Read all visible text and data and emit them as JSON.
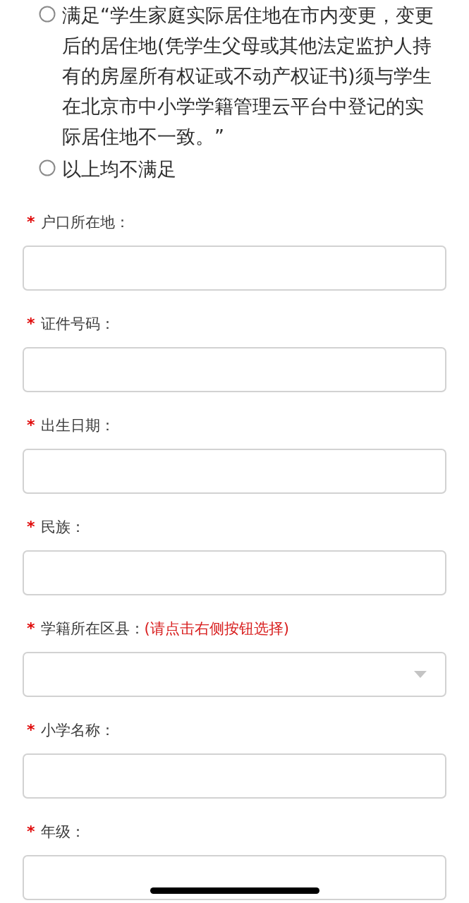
{
  "options": [
    {
      "label": "满足“学生家庭实际居住地在市内变更，变更后的居住地(凭学生父母或其他法定监护人持有的房屋所有权证或不动产权证书)须与学生在北京市中小学学籍管理云平台中登记的实际居住地不一致。”",
      "selected": false
    },
    {
      "label": "以上均不满足",
      "selected": false
    }
  ],
  "fields": [
    {
      "mark": "*",
      "label": "户口所在地：",
      "kind": "text"
    },
    {
      "mark": "*",
      "label": "证件号码：",
      "kind": "text"
    },
    {
      "mark": "*",
      "label": "出生日期：",
      "kind": "text"
    },
    {
      "mark": "*",
      "label": "民族：",
      "kind": "text"
    },
    {
      "mark": "*",
      "label": "学籍所在区县：",
      "hint": "(请点击右侧按钮选择)",
      "kind": "select"
    },
    {
      "mark": "*",
      "label": "小学名称：",
      "kind": "text"
    },
    {
      "mark": "*",
      "label": "年级：",
      "kind": "text"
    }
  ]
}
